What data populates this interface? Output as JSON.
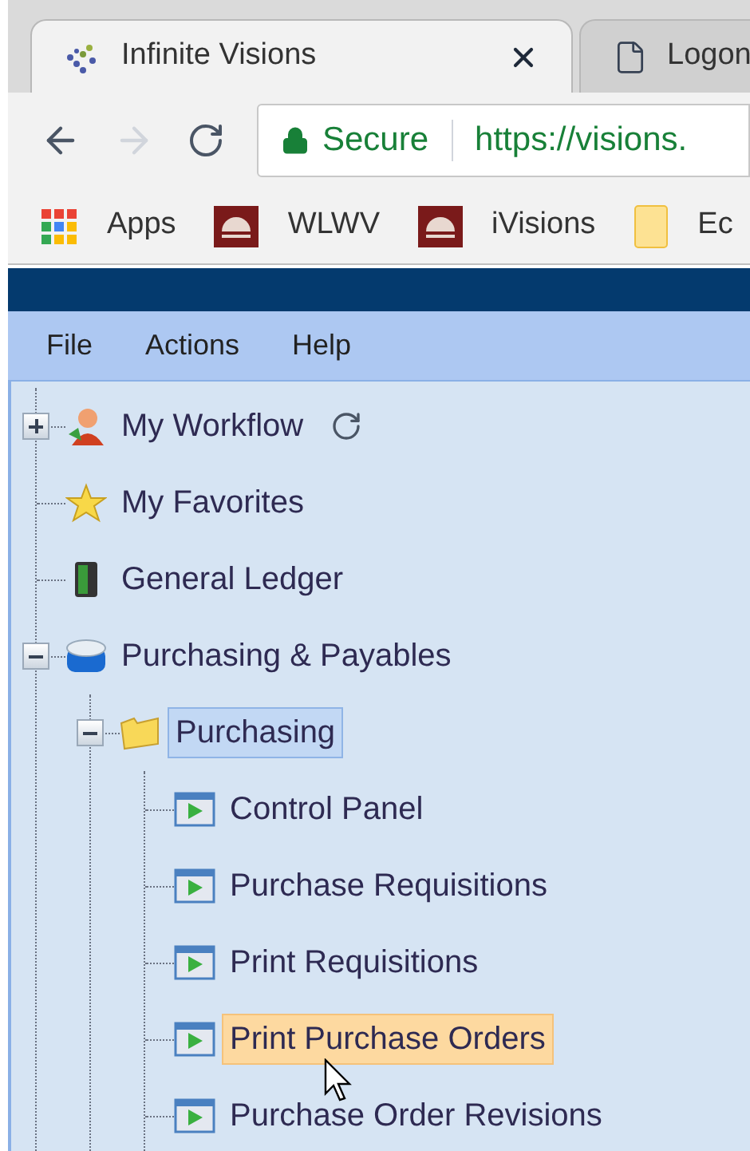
{
  "browser": {
    "tabs": [
      {
        "title": "Infinite Visions",
        "selected": true,
        "kind": "logo"
      },
      {
        "title": "Logon",
        "selected": false,
        "kind": "page"
      }
    ],
    "toolbar": {
      "back_disabled": false,
      "forward_disabled": true,
      "security": "Secure",
      "url": "https://visions."
    },
    "bookmarks": [
      {
        "label": "Apps",
        "kind": "apps"
      },
      {
        "label": "WLWV",
        "kind": "crest"
      },
      {
        "label": "iVisions",
        "kind": "crest"
      },
      {
        "label": "Ec",
        "kind": "folder"
      }
    ]
  },
  "menu": [
    "File",
    "Actions",
    "Help"
  ],
  "tree": [
    {
      "label": "My Workflow",
      "kind": "person",
      "expanded": false,
      "refresh": true,
      "selected": false,
      "hot": false
    },
    {
      "label": "My Favorites",
      "kind": "star",
      "selected": false,
      "hot": false
    },
    {
      "label": "General Ledger",
      "kind": "binder",
      "selected": false,
      "hot": false
    },
    {
      "label": "Purchasing & Payables",
      "kind": "box",
      "expanded": true,
      "selected": false,
      "hot": false,
      "children": [
        {
          "label": "Purchasing",
          "kind": "folder",
          "expanded": true,
          "selected": true,
          "hot": false,
          "children": [
            {
              "label": "Control Panel",
              "kind": "form",
              "selected": false,
              "hot": false
            },
            {
              "label": "Purchase Requisitions",
              "kind": "form",
              "selected": false,
              "hot": false
            },
            {
              "label": "Print Requisitions",
              "kind": "form",
              "selected": false,
              "hot": false
            },
            {
              "label": "Print Purchase Orders",
              "kind": "form",
              "selected": false,
              "hot": true
            },
            {
              "label": "Purchase Order Revisions",
              "kind": "form",
              "selected": false,
              "hot": false
            }
          ]
        }
      ]
    }
  ]
}
